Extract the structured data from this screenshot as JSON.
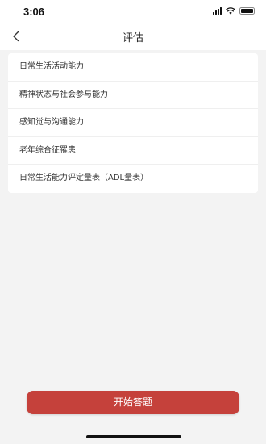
{
  "status_bar": {
    "time": "3:06",
    "icons": [
      "signal-icon",
      "wifi-icon",
      "battery-icon"
    ]
  },
  "nav": {
    "title": "评估",
    "back_icon": "chevron-left-icon"
  },
  "list": {
    "items": [
      {
        "label": "日常生活活动能力"
      },
      {
        "label": "精神状态与社会参与能力"
      },
      {
        "label": "感知觉与沟通能力"
      },
      {
        "label": "老年综合征罹患"
      },
      {
        "label": "日常生活能力评定量表（ADL量表）"
      }
    ]
  },
  "footer": {
    "start_button_label": "开始答题"
  },
  "colors": {
    "background": "#f3f3f3",
    "card": "#ffffff",
    "accent": "#c5413b"
  }
}
